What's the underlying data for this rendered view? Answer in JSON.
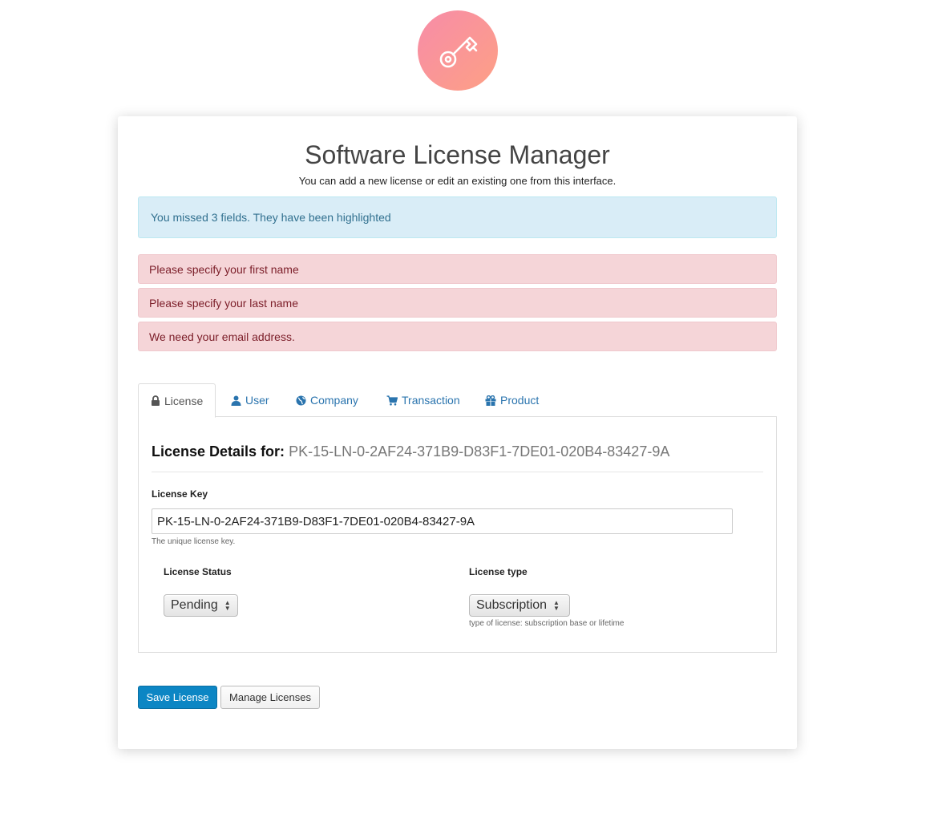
{
  "header": {
    "logo_icon": "key-icon",
    "logo_gradient": [
      "#f78ca8",
      "#fda085"
    ]
  },
  "card": {
    "title": "Software License Manager",
    "subtitle": "You can add a new license or edit an existing one from this interface."
  },
  "alerts": {
    "info": "You missed 3 fields. They have been highlighted",
    "errors": [
      "Please specify your first name",
      "Please specify your last name",
      "We need your email address."
    ]
  },
  "tabs": [
    {
      "label": "License",
      "icon": "lock-icon",
      "active": true
    },
    {
      "label": "User",
      "icon": "user-icon",
      "active": false
    },
    {
      "label": "Company",
      "icon": "globe-icon",
      "active": false
    },
    {
      "label": "Transaction",
      "icon": "cart-icon",
      "active": false
    },
    {
      "label": "Product",
      "icon": "gift-icon",
      "active": false
    }
  ],
  "license": {
    "details_label": "License Details for:",
    "details_value": "PK-15-LN-0-2AF24-371B9-D83F1-7DE01-020B4-83427-9A",
    "key_label": "License Key",
    "key_value": "PK-15-LN-0-2AF24-371B9-D83F1-7DE01-020B4-83427-9A",
    "key_help": "The unique license key.",
    "status_label": "License Status",
    "status_value": "Pending",
    "type_label": "License type",
    "type_value": "Subscription",
    "type_help": "type of license: subscription base or lifetime"
  },
  "actions": {
    "save_label": "Save License",
    "manage_label": "Manage Licenses"
  },
  "colors": {
    "primary": "#0c86c4",
    "link": "#2a74ae",
    "info_bg": "#d9edf7",
    "danger_bg": "#f5d5d8"
  }
}
